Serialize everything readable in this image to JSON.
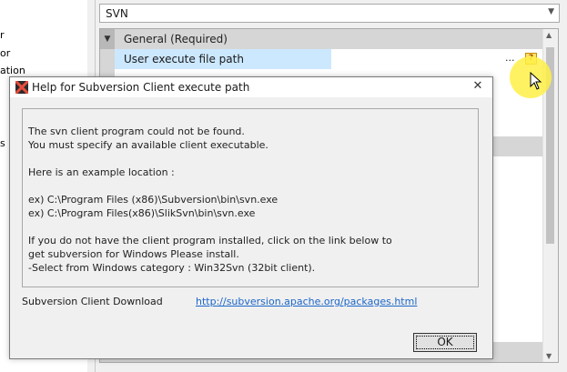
{
  "left_panel": {
    "items": [
      "r",
      "or",
      "ation",
      "s"
    ]
  },
  "svn_combo": {
    "value": "SVN",
    "arrow_icon": "chevron-down-icon"
  },
  "property_grid": {
    "category": "General (Required)",
    "rows": [
      {
        "name": "User execute file path",
        "value": "",
        "ellipsis": "...",
        "help": "?"
      }
    ]
  },
  "dialog": {
    "title": "Help for Subversion Client execute path",
    "close": "✕",
    "message_lines": [
      "The svn client program could not be found.",
      "You must specify an available client executable.",
      "",
      "Here is an example location :",
      "",
      "ex)   C:\\Program Files (x86)\\Subversion\\bin\\svn.exe",
      "ex)   C:\\Program Files(x86)\\SlikSvn\\bin\\svn.exe",
      "",
      "If you do not have the client program installed, click on the link below to",
      "get subversion for Windows Please install.",
      "  -Select from Windows category : Win32Svn (32bit client)."
    ],
    "download_label": "Subversion Client Download",
    "download_link": "http://subversion.apache.org/packages.html",
    "ok_label": "OK"
  }
}
